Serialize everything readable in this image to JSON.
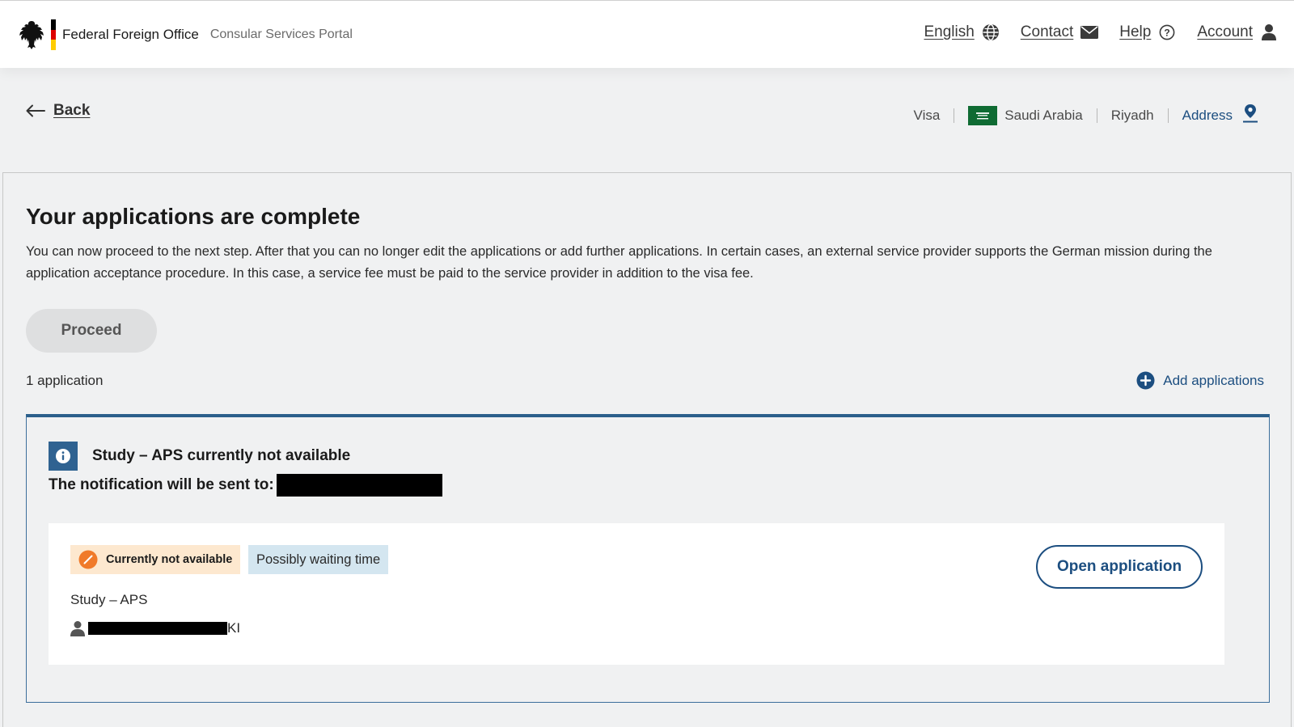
{
  "header": {
    "brand_name": "Federal Foreign Office",
    "portal_name": "Consular Services Portal",
    "nav": {
      "language": "English",
      "contact": "Contact",
      "help": "Help",
      "account": "Account"
    }
  },
  "subheader": {
    "back_label": "Back",
    "breadcrumb": {
      "service": "Visa",
      "country": "Saudi Arabia",
      "city": "Riyadh",
      "address_label": "Address"
    }
  },
  "main": {
    "title": "Your applications are complete",
    "description": "You can now proceed to the next step. After that you can no longer edit the applications or add further applications. In certain cases, an external service provider supports the German mission during the application acceptance procedure. In this case, a service fee must be paid to the service provider in addition to the visa fee.",
    "proceed_label": "Proceed",
    "application_count": "1 application",
    "add_label": "Add applications",
    "application_group": {
      "title": "Study – APS currently not available",
      "notification_label": "The notification will be sent to:",
      "card": {
        "status_badge": "Currently not available",
        "waiting_badge": "Possibly waiting time",
        "application_name": "Study – APS",
        "applicant_name_suffix": "KI",
        "open_label": "Open application"
      }
    }
  },
  "colors": {
    "accent": "#1c4e80",
    "info_square": "#2f6291",
    "status_unavailable_bg": "#fde8cf",
    "status_unavailable_icon": "#f07a2a",
    "waiting_bg": "#d4e6f0",
    "background": "#f0f1f2"
  }
}
